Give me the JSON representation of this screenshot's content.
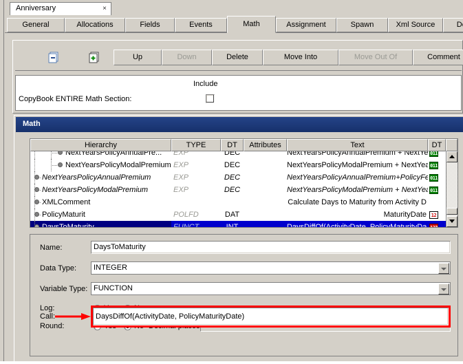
{
  "document_tab": {
    "title": "Anniversary",
    "close_icon": "close-icon"
  },
  "tabs": [
    {
      "label": "General",
      "active": false
    },
    {
      "label": "Allocations",
      "active": false
    },
    {
      "label": "Fields",
      "active": false
    },
    {
      "label": "Events",
      "active": false
    },
    {
      "label": "Math",
      "active": true
    },
    {
      "label": "Assignment",
      "active": false
    },
    {
      "label": "Spawn",
      "active": false
    },
    {
      "label": "Xml Source",
      "active": false
    },
    {
      "label": "Debug",
      "active": false
    }
  ],
  "toolbar": {
    "collapse_icon": "collapse-all-icon",
    "expand_icon": "expand-all-icon",
    "buttons": [
      {
        "label": "Up",
        "disabled": false
      },
      {
        "label": "Down",
        "disabled": true
      },
      {
        "label": "Delete",
        "disabled": false
      },
      {
        "label": "Move Into",
        "disabled": false
      },
      {
        "label": "Move Out Of",
        "disabled": true
      },
      {
        "label": "Comment",
        "disabled": false
      }
    ]
  },
  "copybook": {
    "include_label": "Include",
    "row_label": "CopyBook ENTIRE Math Section:",
    "checked": false
  },
  "math_group": {
    "title": "Math"
  },
  "grid": {
    "columns": [
      {
        "label": "Hierarchy"
      },
      {
        "label": "TYPE"
      },
      {
        "label": "DT"
      },
      {
        "label": "Attributes"
      },
      {
        "label": "Text"
      },
      {
        "label": "DT"
      }
    ],
    "rows": [
      {
        "hierarchy": "NextYearsPolicyAnnualPre...",
        "type": "EXP",
        "dt": "DEC",
        "attributes": "",
        "text": "NextYearsPolicyAnnualPremium + NextYea",
        "dt_icon": "011",
        "dt_icon_color": "green",
        "indent": 2,
        "selected": false,
        "italic": false,
        "clipped": true
      },
      {
        "hierarchy": "NextYearsPolicyModalPremium",
        "type": "EXP",
        "dt": "DEC",
        "attributes": "",
        "text": "NextYearsPolicyModalPremium + NextYear",
        "dt_icon": "011",
        "dt_icon_color": "green",
        "indent": 2,
        "selected": false,
        "italic": false,
        "clipped": false
      },
      {
        "hierarchy": "NextYearsPolicyAnnualPremium",
        "type": "EXP",
        "dt": "DEC",
        "attributes": "",
        "text": "NextYearsPolicyAnnualPremium+PolicyFee",
        "dt_icon": "011",
        "dt_icon_color": "green",
        "indent": 1,
        "selected": false,
        "italic": true,
        "clipped": false
      },
      {
        "hierarchy": "NextYearsPolicyModalPremium",
        "type": "EXP",
        "dt": "DEC",
        "attributes": "",
        "text": "NextYearsPolicyModalPremium + NextYear",
        "dt_icon": "011",
        "dt_icon_color": "green",
        "indent": 1,
        "selected": false,
        "italic": true,
        "clipped": false
      },
      {
        "hierarchy": "XMLComment",
        "type": "",
        "dt": "",
        "attributes": "",
        "text": "Calculate Days to Maturity from Activity D",
        "dt_icon": "",
        "dt_icon_color": "",
        "indent": 1,
        "selected": false,
        "italic": false,
        "clipped": false
      },
      {
        "hierarchy": "PolicyMaturit",
        "type": "POLFD",
        "dt": "DAT",
        "attributes": "",
        "text": "MaturityDate",
        "dt_icon": "12",
        "dt_icon_color": "white",
        "indent": 1,
        "selected": false,
        "italic": false,
        "clipped": false
      },
      {
        "hierarchy": "DaysToMaturity",
        "type": "FUNCT",
        "dt": "INT",
        "attributes": "",
        "text": "DaysDiffOf(ActivityDate, PolicyMaturityDa",
        "dt_icon": "123",
        "dt_icon_color": "red",
        "indent": 1,
        "selected": true,
        "italic": false,
        "clipped": false
      }
    ]
  },
  "form": {
    "name_label": "Name:",
    "name_value": "DaysToMaturity",
    "data_type_label": "Data Type:",
    "data_type_value": "INTEGER",
    "variable_type_label": "Variable Type:",
    "variable_type_value": "FUNCTION",
    "log_label": "Log:",
    "log_yes": "Yes",
    "log_no": "No",
    "log_selected": "No",
    "round_label": "Round:",
    "round_yes": "Yes",
    "round_no": "No",
    "round_selected": "No",
    "decimal_places_label": "Decimal places:",
    "decimal_places_value": "",
    "call_label": "Call:",
    "call_value": "DaysDiffOf(ActivityDate, PolicyMaturityDate)"
  },
  "annotation": {
    "highlight_color": "#ff0000",
    "arrow_icon": "red-arrow-icon"
  }
}
